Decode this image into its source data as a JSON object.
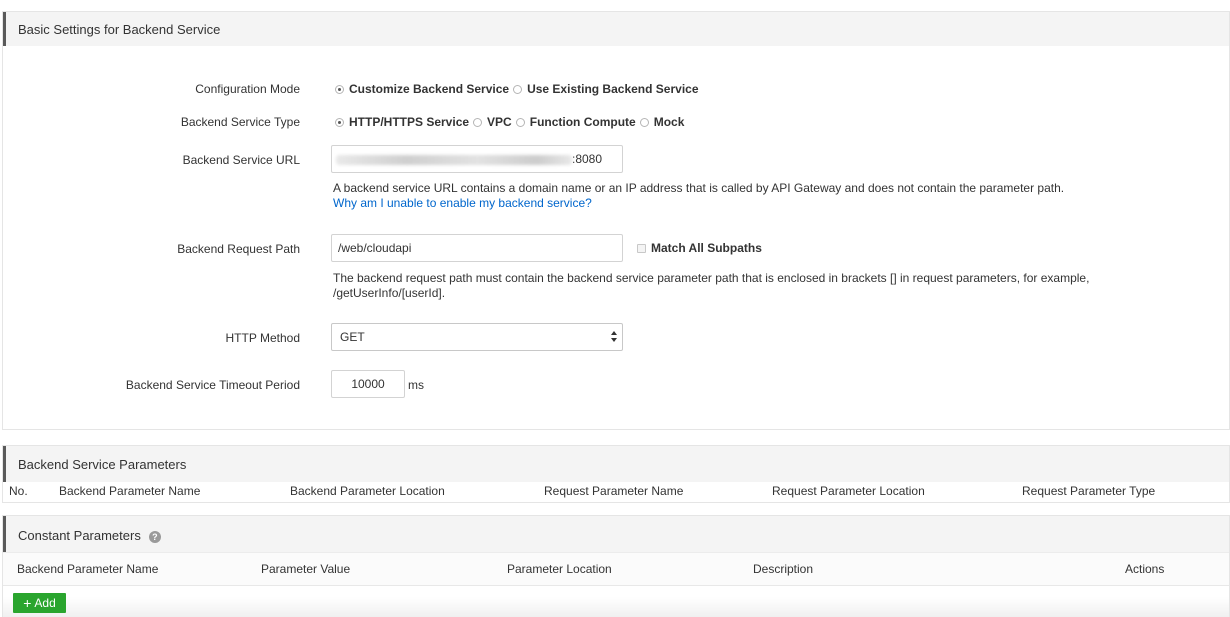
{
  "basic": {
    "title": "Basic Settings for Backend Service",
    "config_mode": {
      "label": "Configuration Mode",
      "options": [
        "Customize Backend Service",
        "Use Existing Backend Service"
      ],
      "selected": "Customize Backend Service"
    },
    "service_type": {
      "label": "Backend Service Type",
      "options": [
        "HTTP/HTTPS Service",
        "VPC",
        "Function Compute",
        "Mock"
      ],
      "selected": "HTTP/HTTPS Service"
    },
    "service_url": {
      "label": "Backend Service URL",
      "value_suffix": ":8080",
      "help": "A backend service URL contains a domain name or an IP address that is called by API Gateway and does not contain the parameter path.",
      "link": "Why am I unable to enable my backend service?"
    },
    "request_path": {
      "label": "Backend Request Path",
      "value": "/web/cloudapi",
      "match_all": "Match All Subpaths",
      "help_line1": "The backend request path must contain the backend service parameter path that is enclosed in brackets [] in request parameters, for example,",
      "help_line2": "/getUserInfo/[userId]."
    },
    "http_method": {
      "label": "HTTP Method",
      "value": "GET"
    },
    "timeout": {
      "label": "Backend Service Timeout Period",
      "value": "10000",
      "unit": "ms"
    }
  },
  "backend_params": {
    "title": "Backend Service Parameters",
    "columns": [
      "No.",
      "Backend Parameter Name",
      "Backend Parameter Location",
      "Request Parameter Name",
      "Request Parameter Location",
      "Request Parameter Type"
    ]
  },
  "constant_params": {
    "title": "Constant Parameters",
    "help_icon": "?",
    "columns": [
      "Backend Parameter Name",
      "Parameter Value",
      "Parameter Location",
      "Description",
      "Actions"
    ],
    "add_button": "Add"
  }
}
